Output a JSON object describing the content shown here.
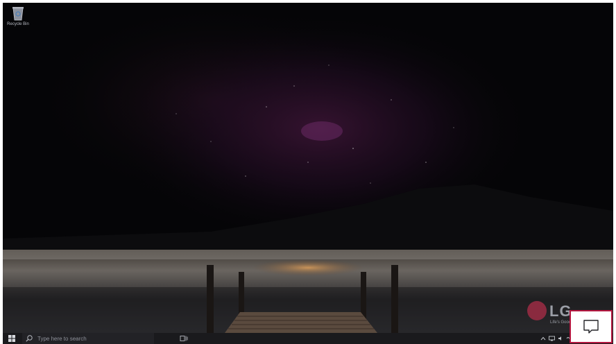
{
  "desktop": {
    "icons": [
      {
        "label": "Recycle Bin",
        "icon": "recycle-bin-icon"
      }
    ]
  },
  "brand": {
    "letters": "LG",
    "tagline": "Life's Good"
  },
  "taskbar": {
    "start_icon": "windows-logo-icon",
    "search": {
      "icon": "search-icon",
      "placeholder": "Type here to search"
    },
    "taskview_icon": "task-view-icon",
    "tray_icons": [
      "chevron-up-icon",
      "network-icon",
      "volume-icon",
      "speaker-icon"
    ],
    "action_center_icon": "notification-icon"
  },
  "colors": {
    "highlight_border": "#b3163f",
    "taskbar": "#1a1a1d"
  }
}
